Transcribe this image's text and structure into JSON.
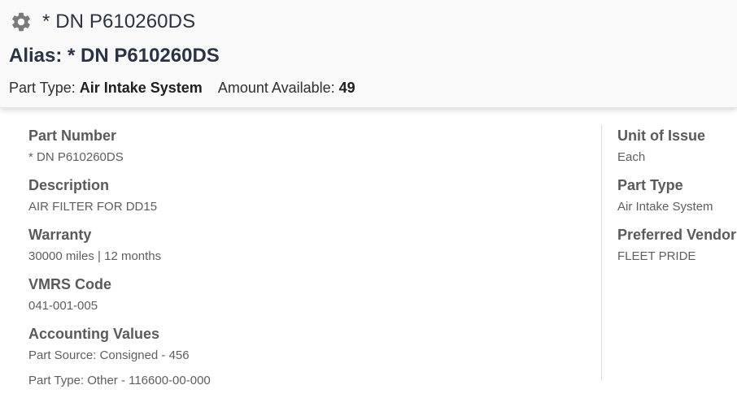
{
  "header": {
    "icon": "gear-icon",
    "title": "* DN P610260DS",
    "alias_label": "Alias:",
    "alias_value": "* DN P610260DS",
    "part_type_label": "Part Type:",
    "part_type_value": "Air Intake System",
    "amount_label": "Amount Available:",
    "amount_value": "49"
  },
  "details": {
    "part_number_label": "Part Number",
    "part_number_value": "* DN P610260DS",
    "description_label": "Description",
    "description_value": "AIR FILTER FOR DD15",
    "warranty_label": "Warranty",
    "warranty_value": "30000 miles | 12 months",
    "vmrs_label": "VMRS Code",
    "vmrs_value": "041-001-005",
    "accounting_label": "Accounting Values",
    "accounting_values": [
      "Part Source: Consigned - 456",
      "Part Type: Other - 116600-00-000"
    ]
  },
  "side": {
    "unit_label": "Unit of Issue",
    "unit_value": "Each",
    "part_type_label": "Part Type",
    "part_type_value": "Air Intake System",
    "vendor_label": "Preferred Vendor",
    "vendor_value": "FLEET PRIDE"
  },
  "colors": {
    "header_bg": "#f9f9f9",
    "title": "#2b3340",
    "label": "#5a5a5a",
    "value": "#5e5e5e",
    "gear": "#7a7a7a"
  }
}
